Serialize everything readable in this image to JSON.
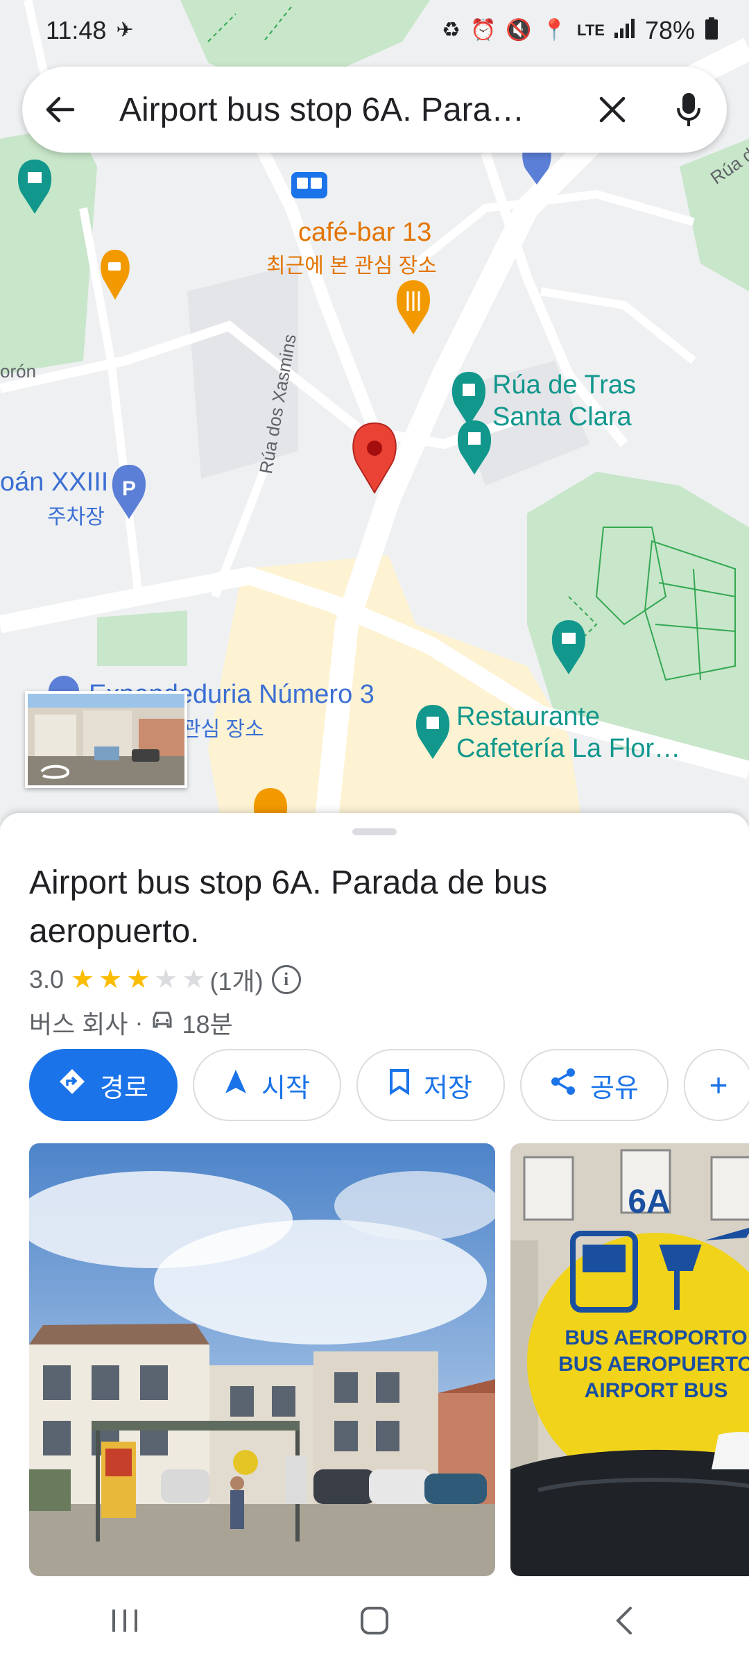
{
  "status_bar": {
    "time": "11:48",
    "battery": "78%",
    "network": "LTE"
  },
  "search": {
    "query": "Airport bus stop 6A. Para…",
    "back_icon": "arrow-back-icon",
    "clear_icon": "close-icon",
    "mic_icon": "mic-icon"
  },
  "map": {
    "labels": {
      "street_top": "Rúa do Hórreo",
      "cafe_bar": "café-bar 13",
      "cafe_bar_sub": "최근에 본 관심 장소",
      "rua_tras": "Rúa de Tras\nSanta Clara",
      "rua_xasmins": "Rúa dos Xasmins",
      "pan_xxiii": "oán XXIII",
      "parking_sub": "주차장",
      "expendeduria": "Expendeduria Número 3",
      "expendeduria_sub": "관심 장소",
      "restaurante": "Restaurante\nCafetería La Flor…",
      "left_edge": "orón",
      "right_edge": "Rúa de"
    },
    "accent_colors": {
      "park": "#c8e6c9",
      "road": "#ffffff",
      "pin_red": "#ea4335",
      "teal": "#12978d",
      "orange": "#f29900",
      "blue": "#5b7fd6"
    }
  },
  "place": {
    "title": "Airport bus stop 6A. Parada de bus aeropuerto.",
    "rating": "3.0",
    "stars": 3,
    "review_count": "(1개)",
    "category": "버스 회사",
    "travel_time": "18분",
    "separator": "·"
  },
  "actions": {
    "directions": "경로",
    "start": "시작",
    "save": "저장",
    "share": "공유",
    "more": "+"
  },
  "photo_sign": {
    "line0": "6A",
    "line1": "BUS AEROPORTO",
    "line2": "BUS AEROPUERTO",
    "line3": "AIRPORT BUS"
  },
  "nav": {
    "recents_icon": "recents-icon",
    "home_icon": "home-icon",
    "back_icon": "back-icon"
  }
}
